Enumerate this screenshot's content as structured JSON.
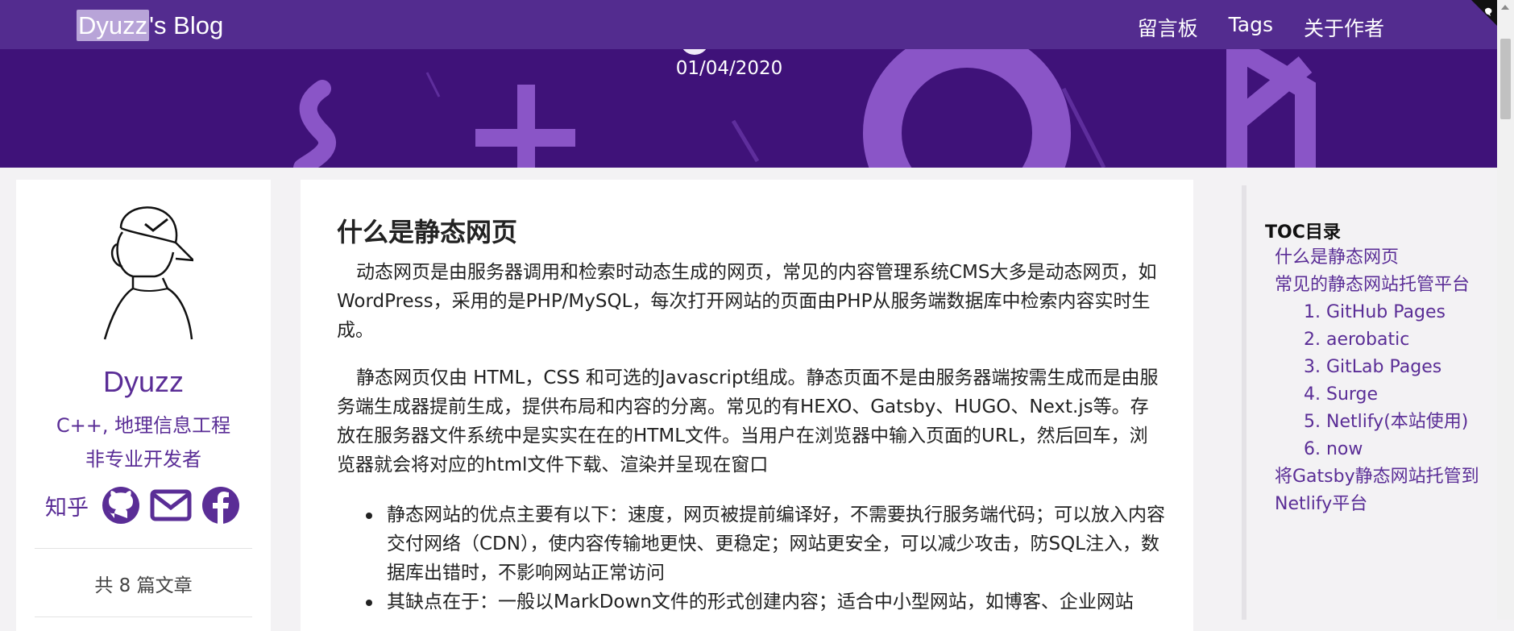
{
  "brand": {
    "highlight": "Dyuzz",
    "rest": "'s Blog"
  },
  "nav": [
    "留言板",
    "Tags",
    "关于作者"
  ],
  "hero": {
    "date": "01/04/2020"
  },
  "profile": {
    "name": "Dyuzz",
    "desc_line1": "C++, 地理信息工程",
    "desc_line2": "非专业开发者",
    "zhihu": "知乎",
    "count": "共 8 篇文章"
  },
  "article": {
    "heading": "什么是静态网页",
    "para1": "动态网页是由服务器调用和检索时动态生成的网页，常见的内容管理系统CMS大多是动态网页，如WordPress，采用的是PHP/MySQL，每次打开网站的页面由PHP从服务端数据库中检索内容实时生成。",
    "para2": "静态网页仅由 HTML，CSS 和可选的Javascript组成。静态页面不是由服务器端按需生成而是由服务端生成器提前生成，提供布局和内容的分离。常见的有HEXO、Gatsby、HUGO、Next.js等。存放在服务器文件系统中是实实在在的HTML文件。当用户在浏览器中输入页面的URL，然后回车，浏览器就会将对应的html文件下载、渲染并呈现在窗口",
    "bullets": [
      "静态网站的优点主要有以下：速度，网页被提前编译好，不需要执行服务端代码；可以放入内容交付网络（CDN），使内容传输地更快、更稳定；网站更安全，可以减少攻击，防SQL注入，数据库出错时，不影响网站正常访问",
      "其缺点在于：一般以MarkDown文件的形式创建内容；适合中小型网站，如博客、企业网站"
    ]
  },
  "toc": {
    "title": "TOC目录",
    "items": [
      {
        "label": "什么是静态网页",
        "sub": false
      },
      {
        "label": "常见的静态网站托管平台",
        "sub": false
      },
      {
        "label": "1. GitHub Pages",
        "sub": true
      },
      {
        "label": "2. aerobatic",
        "sub": true
      },
      {
        "label": "3. GitLab Pages",
        "sub": true
      },
      {
        "label": "4. Surge",
        "sub": true
      },
      {
        "label": "5. Netlify(本站使用)",
        "sub": true
      },
      {
        "label": "6. now",
        "sub": true
      },
      {
        "label": "将Gatsby静态网站托管到",
        "sub": false
      },
      {
        "label": "Netlify平台",
        "sub": false
      }
    ]
  },
  "colors": {
    "hero": "#3f1279",
    "nav": "#532c8f",
    "accent": "#5a2d96"
  },
  "icons": [
    "github-icon",
    "mail-icon",
    "facebook-icon"
  ]
}
